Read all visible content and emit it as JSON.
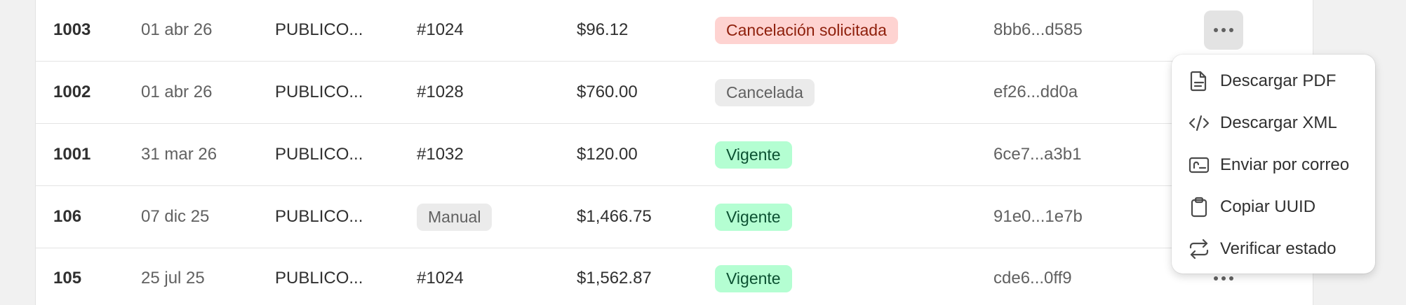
{
  "rows": [
    {
      "folio": "1003",
      "fecha": "01 abr 26",
      "cliente": "PUBLICO...",
      "pedido": "#1024",
      "pedido_tipo": "text",
      "total": "$96.12",
      "estado": "Cancelación solicitada",
      "estado_tone": "danger",
      "uuid": "8bb6...d585"
    },
    {
      "folio": "1002",
      "fecha": "01 abr 26",
      "cliente": "PUBLICO...",
      "pedido": "#1028",
      "pedido_tipo": "text",
      "total": "$760.00",
      "estado": "Cancelada",
      "estado_tone": "neutral",
      "uuid": "ef26...dd0a"
    },
    {
      "folio": "1001",
      "fecha": "31 mar 26",
      "cliente": "PUBLICO...",
      "pedido": "#1032",
      "pedido_tipo": "text",
      "total": "$120.00",
      "estado": "Vigente",
      "estado_tone": "success",
      "uuid": "6ce7...a3b1"
    },
    {
      "folio": "106",
      "fecha": "07 dic 25",
      "cliente": "PUBLICO...",
      "pedido": "Manual",
      "pedido_tipo": "badge",
      "total": "$1,466.75",
      "estado": "Vigente",
      "estado_tone": "success",
      "uuid": "91e0...1e7b"
    },
    {
      "folio": "105",
      "fecha": "25 jul 25",
      "cliente": "PUBLICO...",
      "pedido": "#1024",
      "pedido_tipo": "text",
      "total": "$1,562.87",
      "estado": "Vigente",
      "estado_tone": "success",
      "uuid": "cde6...0ff9"
    }
  ],
  "actions_icon": "more-horizontal-icon",
  "menu": {
    "items": [
      {
        "label": "Descargar PDF",
        "icon": "file-icon"
      },
      {
        "label": "Descargar XML",
        "icon": "code-icon"
      },
      {
        "label": "Enviar por correo",
        "icon": "email-card-icon"
      },
      {
        "label": "Copiar UUID",
        "icon": "clipboard-icon"
      },
      {
        "label": "Verificar estado",
        "icon": "refresh-icon"
      }
    ]
  },
  "colors": {
    "danger_bg": "#fed3d1",
    "danger_text": "#8e1f0b",
    "neutral_bg": "#ebebeb",
    "neutral_text": "#616161",
    "success_bg": "#b4fed2",
    "success_text": "#0c5132"
  }
}
